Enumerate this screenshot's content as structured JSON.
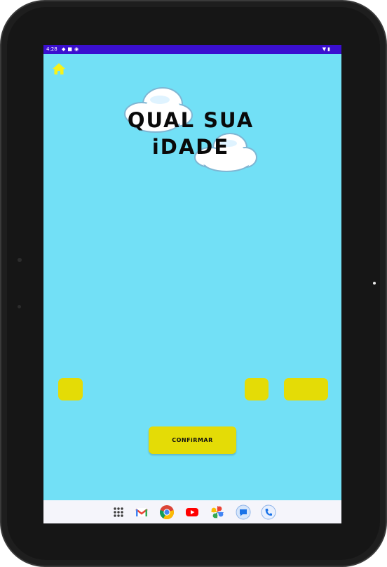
{
  "status_bar": {
    "time": "4:28",
    "left_icons": [
      "notification-icon",
      "sd-card-icon",
      "app-icon"
    ],
    "right_icons": [
      "wifi-icon",
      "battery-icon"
    ]
  },
  "toolbar": {
    "home_icon": "home-icon",
    "home_color": "#f7f21a"
  },
  "title": {
    "line1": "QUAL SUA",
    "line2": "iDADE"
  },
  "inputs": {
    "day_value": "",
    "month_value": "",
    "year_value": "",
    "fill_color": "#e4dc06"
  },
  "confirm_button": {
    "label": "CONFiRMAR"
  },
  "dock": {
    "apps": [
      "app-drawer-icon",
      "gmail-icon",
      "chrome-icon",
      "youtube-icon",
      "photos-icon",
      "messages-icon",
      "phone-icon"
    ]
  },
  "colors": {
    "background": "#72e0f6",
    "status_bar": "#3a0fd0",
    "accent": "#e4dc06"
  }
}
